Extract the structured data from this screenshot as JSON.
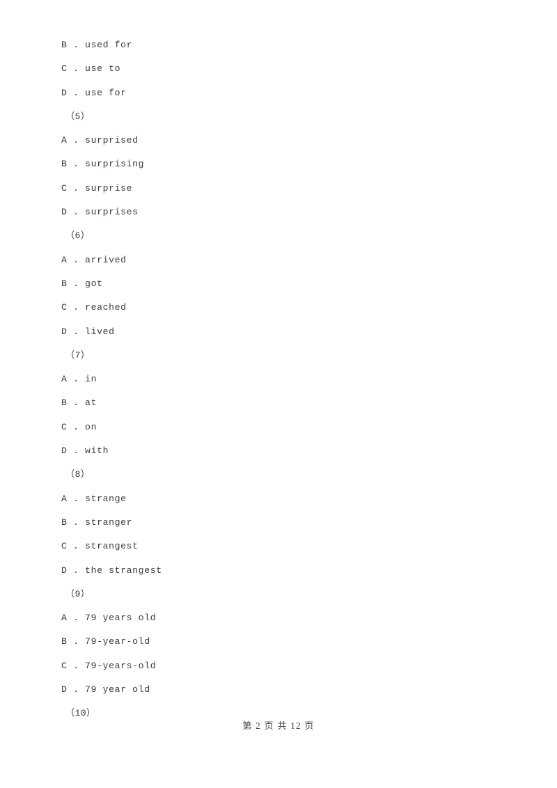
{
  "document": {
    "background_color": "#ffffff",
    "text_color": "#3a3a3a"
  },
  "body_lines": [
    {
      "kind": "option",
      "text": "B . used for"
    },
    {
      "kind": "option",
      "text": "C . use to"
    },
    {
      "kind": "option",
      "text": "D . use for"
    },
    {
      "kind": "question-number",
      "text": "（5）"
    },
    {
      "kind": "option",
      "text": "A . surprised"
    },
    {
      "kind": "option",
      "text": "B . surprising"
    },
    {
      "kind": "option",
      "text": "C . surprise"
    },
    {
      "kind": "option",
      "text": "D . surprises"
    },
    {
      "kind": "question-number",
      "text": "（6）"
    },
    {
      "kind": "option",
      "text": "A . arrived"
    },
    {
      "kind": "option",
      "text": "B . got"
    },
    {
      "kind": "option",
      "text": "C . reached"
    },
    {
      "kind": "option",
      "text": "D . lived"
    },
    {
      "kind": "question-number",
      "text": "（7）"
    },
    {
      "kind": "option",
      "text": "A . in"
    },
    {
      "kind": "option",
      "text": "B . at"
    },
    {
      "kind": "option",
      "text": "C . on"
    },
    {
      "kind": "option",
      "text": "D . with"
    },
    {
      "kind": "question-number",
      "text": "（8）"
    },
    {
      "kind": "option",
      "text": "A . strange"
    },
    {
      "kind": "option",
      "text": "B . stranger"
    },
    {
      "kind": "option",
      "text": "C . strangest"
    },
    {
      "kind": "option",
      "text": "D . the strangest"
    },
    {
      "kind": "question-number",
      "text": "（9）"
    },
    {
      "kind": "option",
      "text": "A . 79 years old"
    },
    {
      "kind": "option",
      "text": "B . 79-year-old"
    },
    {
      "kind": "option",
      "text": "C . 79-years-old"
    },
    {
      "kind": "option",
      "text": "D . 79 year old"
    },
    {
      "kind": "question-number",
      "text": "（10）"
    }
  ],
  "footer": {
    "text": "第 2 页 共 12 页",
    "page_number": 2,
    "total_pages": 12
  }
}
